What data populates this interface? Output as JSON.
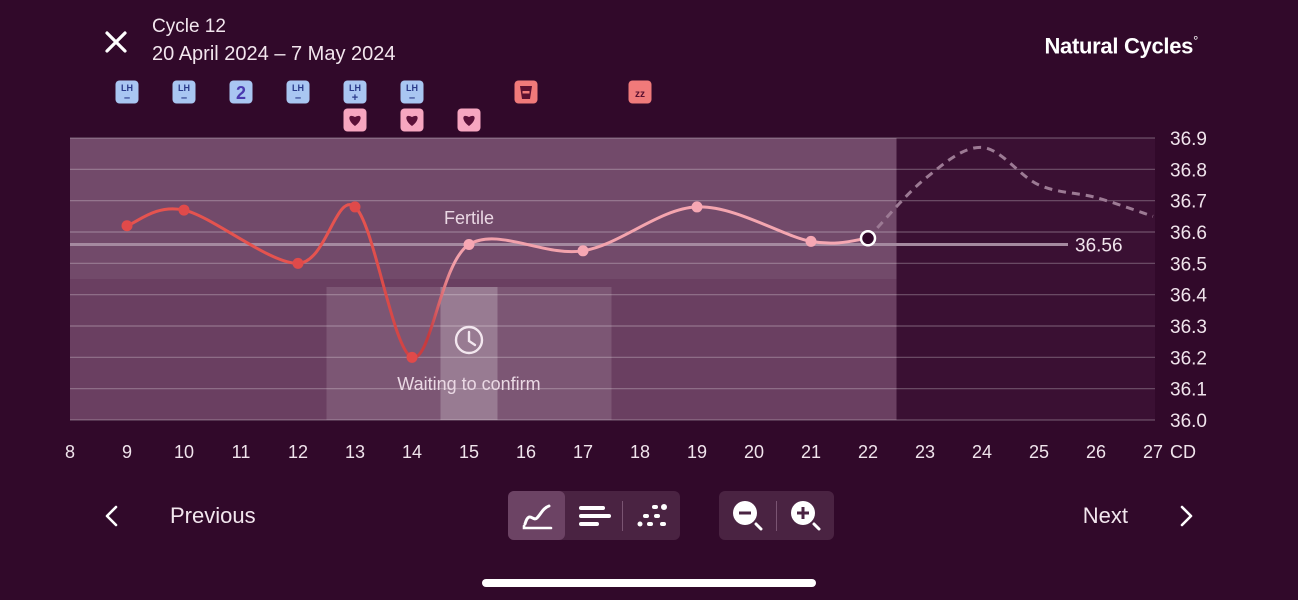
{
  "header": {
    "cycle_title": "Cycle 12",
    "cycle_range": "20 April 2024 – 7 May 2024",
    "brand": "Natural Cycles",
    "brand_mark": "°"
  },
  "markers": {
    "lh_label": "LH",
    "tests": [
      {
        "day": 9,
        "type": "lh-negative",
        "sign": "–"
      },
      {
        "day": 10,
        "type": "lh-negative",
        "sign": "–"
      },
      {
        "day": 11,
        "type": "count",
        "value": "2"
      },
      {
        "day": 12,
        "type": "lh-negative",
        "sign": "–"
      },
      {
        "day": 13,
        "type": "lh-positive",
        "sign": "+"
      },
      {
        "day": 14,
        "type": "lh-negative",
        "sign": "–"
      }
    ],
    "intercourse_days": [
      13,
      14,
      15
    ],
    "symptoms": [
      {
        "day": 16,
        "icon": "cup-icon"
      },
      {
        "day": 18,
        "icon": "sleep-icon",
        "text": "zz"
      }
    ]
  },
  "chart_data": {
    "type": "line",
    "ylabel_unit": "",
    "xlabel": "CD",
    "x_ticks": [
      "8",
      "9",
      "10",
      "11",
      "12",
      "13",
      "14",
      "15",
      "16",
      "17",
      "18",
      "19",
      "20",
      "21",
      "22",
      "23",
      "24",
      "25",
      "26",
      "27"
    ],
    "y_ticks": [
      "36.0",
      "36.1",
      "36.2",
      "36.3",
      "36.4",
      "36.5",
      "36.6",
      "36.7",
      "36.8",
      "36.9"
    ],
    "ylim": [
      36.0,
      36.9
    ],
    "xlim": [
      7.75,
      27
    ],
    "series": [
      {
        "x": [
          9,
          10,
          12,
          13,
          14,
          15,
          17,
          19,
          21,
          22
        ],
        "y": [
          36.62,
          36.67,
          36.5,
          36.68,
          36.2,
          36.56,
          36.54,
          36.68,
          36.57,
          36.58
        ],
        "colors": {
          "low": "#e04a4a",
          "high": "#f6a7b3"
        }
      }
    ],
    "prediction": {
      "x": [
        22,
        23,
        24,
        25,
        26,
        27
      ],
      "y": [
        36.58,
        36.77,
        36.87,
        36.75,
        36.71,
        36.65
      ]
    },
    "coverline": {
      "value": 36.56,
      "label": "36.56"
    },
    "annotations": {
      "fertile": "Fertile",
      "waiting": "Waiting to confirm"
    },
    "fertile_window_days": [
      8,
      22
    ],
    "waiting_days": [
      13,
      17
    ],
    "waiting_highlight_day": 15,
    "grid": true
  },
  "footer": {
    "prev_label": "Previous",
    "next_label": "Next",
    "views": [
      {
        "name": "graph-view",
        "active": true
      },
      {
        "name": "list-view",
        "active": false
      },
      {
        "name": "scatter-view",
        "active": false
      }
    ]
  },
  "colors": {
    "background": "#31092a",
    "lh_badge": "#a9c6f2",
    "heart_badge": "#f7a6c0",
    "symptom_badge": "#f07a7a",
    "curve_low": "#e04a4a",
    "curve_high": "#f6a7b3"
  }
}
